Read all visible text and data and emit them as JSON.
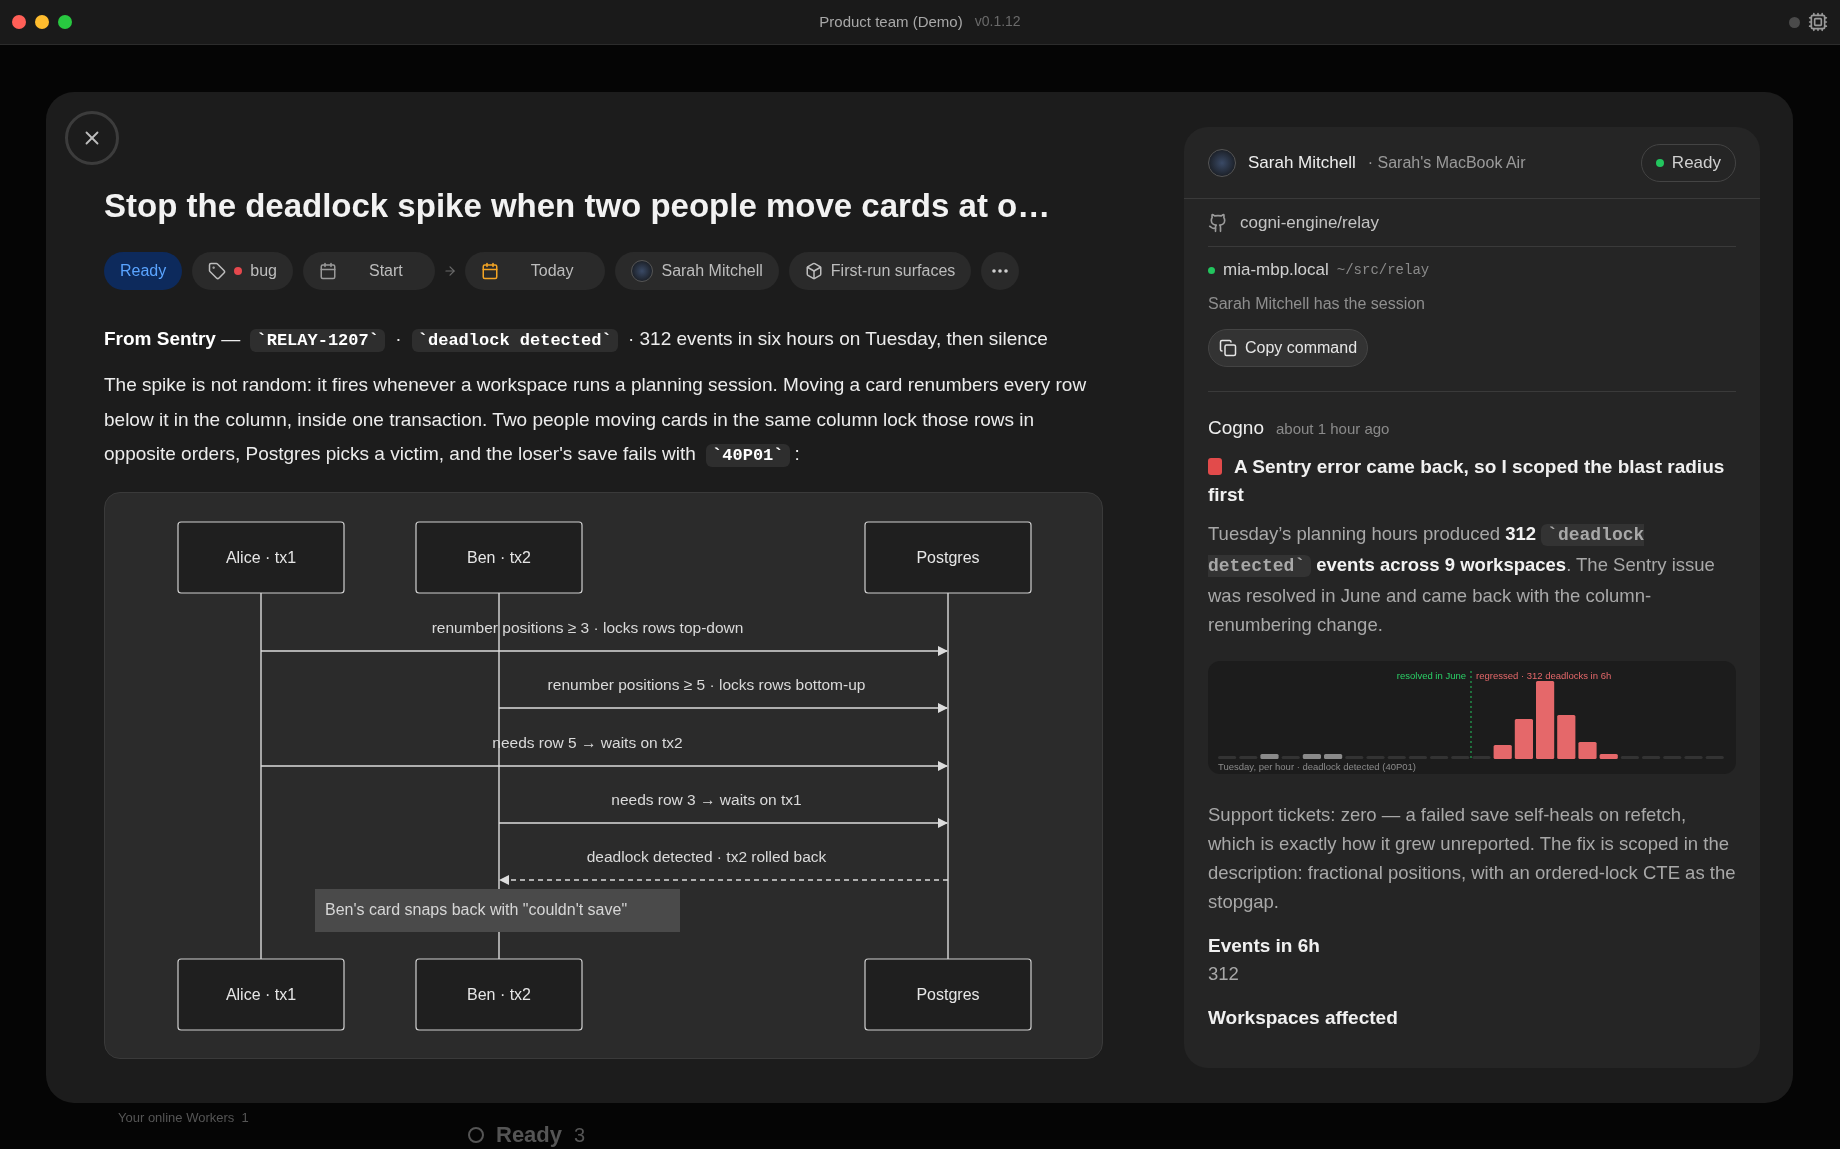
{
  "window": {
    "title": "Product team (Demo)",
    "version": "v0.1.12"
  },
  "background": {
    "workers": "Your online Workers  1",
    "status": "Ready",
    "count": "3"
  },
  "issue": {
    "title": "Stop the deadlock spike when two people move cards at o…",
    "chips": [
      {
        "kind": "status",
        "label": "Ready"
      },
      {
        "kind": "tag",
        "label": "bug",
        "color": "#e5484d"
      },
      {
        "kind": "date",
        "label": "Start",
        "set": false
      },
      {
        "kind": "date",
        "label": "Today",
        "set": true
      },
      {
        "kind": "person",
        "label": "Sarah Mitchell"
      },
      {
        "kind": "project",
        "label": "First-run surfaces"
      },
      {
        "kind": "more"
      }
    ],
    "paragraphs": [
      [
        {
          "kind": "bold",
          "text": "From Sentry"
        },
        {
          "kind": "text",
          "text": " — "
        },
        {
          "kind": "code",
          "text": "`RELAY-1207`"
        },
        {
          "kind": "text",
          "text": " · "
        },
        {
          "kind": "code",
          "text": "`deadlock detected`"
        },
        {
          "kind": "text",
          "text": " · 312 events in six hours on Tuesday, then silence"
        }
      ],
      [
        {
          "kind": "text",
          "text": "The spike is not random: it fires whenever a workspace runs a planning session. Moving a card renumbers every row below it in the column, inside one transaction. Two people moving cards in the same column lock those rows in opposite orders, Postgres picks a victim, and the loser's save fails with "
        },
        {
          "kind": "code",
          "text": "`40P01`"
        },
        {
          "kind": "text",
          "text": ":"
        }
      ]
    ],
    "diagram": {
      "participants_top": [
        "Alice · tx1",
        "Ben · tx2",
        "Postgres"
      ],
      "messages": [
        {
          "label": "renumber positions ≥ 3 · locks rows top-down",
          "kind": "call"
        },
        {
          "label": "renumber positions ≥ 5 · locks rows bottom-up",
          "kind": "call"
        },
        {
          "label": "needs row 5 → waits on tx2",
          "kind": "call"
        },
        {
          "label": "needs row 3 → waits on tx1",
          "kind": "call"
        },
        {
          "label": "deadlock detected · tx2 rolled back",
          "kind": "reply"
        }
      ],
      "participants_bottom": [
        "Alice · tx1",
        "Ben · tx2",
        "Postgres"
      ],
      "note": "Ben's card snaps back with \"couldn't save\""
    }
  },
  "session": {
    "user": "Sarah Mitchell",
    "device": "· Sarah's MacBook Air",
    "status": "Ready",
    "repo": "cogni-engine/relay",
    "host": "mia-mbp.local",
    "path": "~/src/relay",
    "owner_note": "Sarah Mitchell has the session",
    "copy_button": "Copy command"
  },
  "comment": {
    "author": "Cogno",
    "time": "about 1 hour ago",
    "heading": "A Sentry error came back, so I scoped the blast radius first",
    "paragraph": [
      {
        "kind": "text",
        "text": "Tuesday’s planning hours produced "
      },
      {
        "kind": "bold",
        "text": "312"
      },
      {
        "kind": "code",
        "text": "`deadlock detected`"
      },
      {
        "kind": "bold",
        "text": "events across 9 workspaces"
      },
      {
        "kind": "text",
        "text": ". The Sentry issue was resolved in June and came back with the column-renumbering change."
      }
    ],
    "chart": {
      "before_label": "resolved in June",
      "after_label": "regressed · 312 deadlocks in 6h",
      "caption": "Tuesday, per hour · deadlock detected (40P01)"
    },
    "summary": "Support tickets: zero — a failed save self-heals on refetch, which is exactly how it grew unreported. The fix is scoped in the description: fractional positions, with an ordered-lock CTE as the stopgap.",
    "facts": [
      {
        "label": "Events in 6h",
        "value": "312"
      },
      {
        "label": "Workspaces affected"
      }
    ]
  }
}
